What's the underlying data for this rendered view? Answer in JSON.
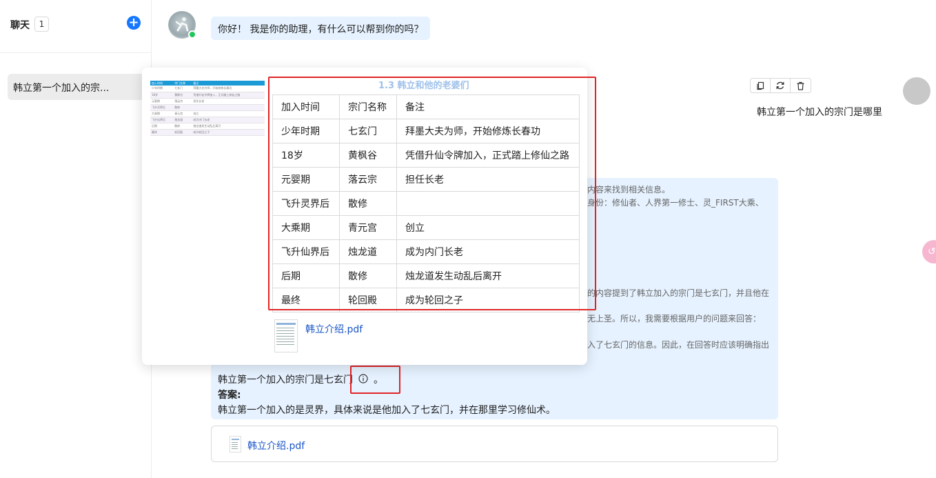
{
  "sidebar": {
    "title": "聊天",
    "count": "1",
    "add_label": "+",
    "items": [
      {
        "label": "韩立第一个加入的宗..."
      }
    ]
  },
  "chat": {
    "greeting": "你好！ 我是你的助理，有什么可以帮到你的吗？",
    "user_message": "韩立第一个加入的宗门是哪里",
    "thinking_lines": [
      "内容来找到相关信息。",
      "身份：修仙者、人界第一修士、灵_FIRST大乘、",
      "的内容提到了韩立加入的宗门是七玄门，并且他在",
      "无上圣。所以，我需要根据用户的问题来回答：",
      "入了七玄门的信息。因此，在回答时应该明确指出"
    ],
    "answer": {
      "conclusion": "韩立第一个加入的宗门是七玄门",
      "period": "。",
      "answer_label": "答案:",
      "answer_text": "韩立第一个加入的是灵界，具体来说是他加入了七玄门，并在那里学习修仙术。"
    },
    "float_bubble": "↺",
    "attachment": {
      "file_name": "韩立介绍.pdf"
    }
  },
  "popover": {
    "section_title": "1.3 韩立和他的老婆们",
    "mini_table": {
      "headers": [
        "加入时间",
        "宗门名称",
        "备注"
      ],
      "rows": [
        [
          "少年时期",
          "七玄门",
          "拜墨大夫为师，开始修炼长春功"
        ],
        [
          "18岁",
          "黄枫谷",
          "凭借升仙令牌加入，正式踏上修仙之路"
        ],
        [
          "元婴期",
          "落云宗",
          "担任长老"
        ],
        [
          "飞升灵界后",
          "散修",
          ""
        ],
        [
          "大乘期",
          "青元宫",
          "创立"
        ],
        [
          "飞升仙界后",
          "烛龙道",
          "成为内门长老"
        ],
        [
          "后期",
          "散修",
          "烛龙道发生动乱后离开"
        ],
        [
          "最终",
          "轮回殿",
          "成为轮回之子"
        ]
      ]
    },
    "table": {
      "headers": [
        "加入时间",
        "宗门名称",
        "备注"
      ],
      "rows": [
        [
          "少年时期",
          "七玄门",
          "拜墨大夫为师，开始修炼长春功"
        ],
        [
          "18岁",
          "黄枫谷",
          "凭借升仙令牌加入，正式踏上修仙之路"
        ],
        [
          "元婴期",
          "落云宗",
          "担任长老"
        ],
        [
          "飞升灵界后",
          "散修",
          ""
        ],
        [
          "大乘期",
          "青元宫",
          "创立"
        ],
        [
          "飞升仙界后",
          "烛龙道",
          "成为内门长老"
        ],
        [
          "后期",
          "散修",
          "烛龙道发生动乱后离开"
        ],
        [
          "最终",
          "轮回殿",
          "成为轮回之子"
        ]
      ]
    },
    "file_name": "韩立介绍.pdf"
  },
  "colors": {
    "accent": "#1677ff",
    "highlight": "#e02424",
    "bubble": "#e6f2ff"
  }
}
